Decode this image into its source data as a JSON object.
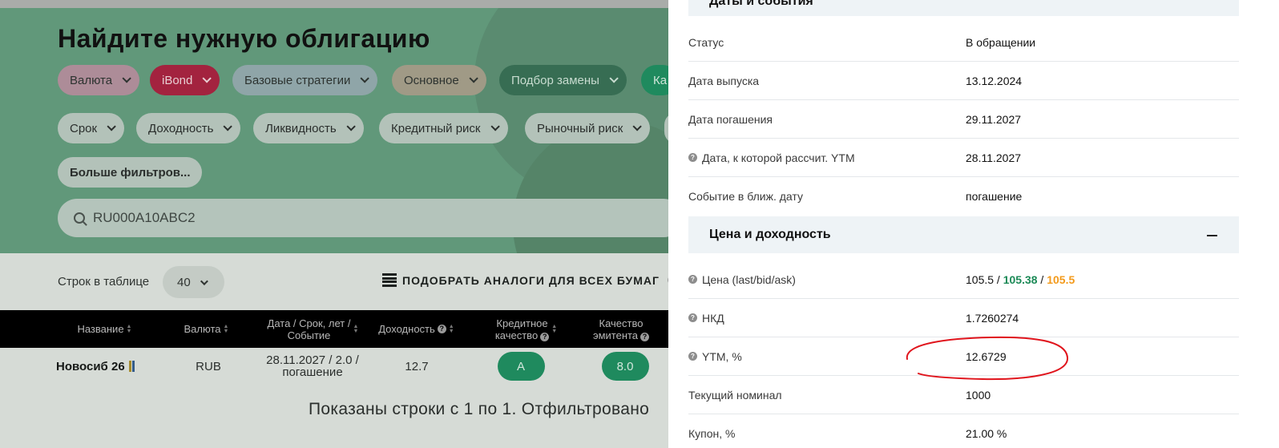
{
  "left": {
    "title": "Найдите нужную облигацию",
    "filters_row1": [
      "Валюта",
      "iBond",
      "Базовые стратегии",
      "Основное",
      "Подбор замены",
      "Ка"
    ],
    "filters_row2": [
      "Срок",
      "Доходность",
      "Ликвидность",
      "Кредитный риск",
      "Рыночный риск"
    ],
    "more_filters": "Больше фильтров...",
    "search_value": "RU000A10ABC2",
    "rows_label": "Строк в таблице",
    "rows_value": "40",
    "analogs_button": "ПОДОБРАТЬ АНАЛОГИ ДЛЯ ВСЕХ БУМАГ",
    "table": {
      "headers": {
        "name": "Название",
        "currency": "Валюта",
        "date_line1": "Дата / Срок, лет /",
        "date_line2": "Событие",
        "yield": "Доходность",
        "credit_line1": "Кредитное",
        "credit_line2": "качество",
        "issuer_line1": "Качество",
        "issuer_line2": "эмитента"
      },
      "row": {
        "name": "Новосиб 26",
        "currency": "RUB",
        "date_line1": "28.11.2027 / 2.0 /",
        "date_line2": "погашение",
        "yield": "12.7",
        "credit": "A",
        "issuer": "8.0"
      }
    },
    "summary": "Показаны строки с 1 по 1. Отфильтровано"
  },
  "panel": {
    "section_dates": "Даты и события",
    "dates_rows": [
      {
        "label": "Статус",
        "value": "В обращении"
      },
      {
        "label": "Дата выпуска",
        "value": "13.12.2024"
      },
      {
        "label": "Дата погашения",
        "value": "29.11.2027"
      },
      {
        "label": "Дата, к которой рассчит. YTM",
        "value": "28.11.2027"
      },
      {
        "label": "Событие в ближ. дату",
        "value": "погашение"
      }
    ],
    "section_price": "Цена и доходность",
    "price": {
      "label": "Цена (last/bid/ask)",
      "last": "105.5",
      "bid": "105.38",
      "ask": "105.5",
      "sep": " / "
    },
    "price_rows": [
      {
        "label": "НКД",
        "value": "1.7260274"
      },
      {
        "label": "YTM, %",
        "value": "12.6729"
      },
      {
        "label": "Текущий номинал",
        "value": "1000"
      },
      {
        "label": "Купон, %",
        "value": "21.00 %"
      }
    ],
    "colors": {
      "bid": "#1c8a57",
      "ask": "#f39a1b",
      "annotation": "#e0141c"
    }
  }
}
